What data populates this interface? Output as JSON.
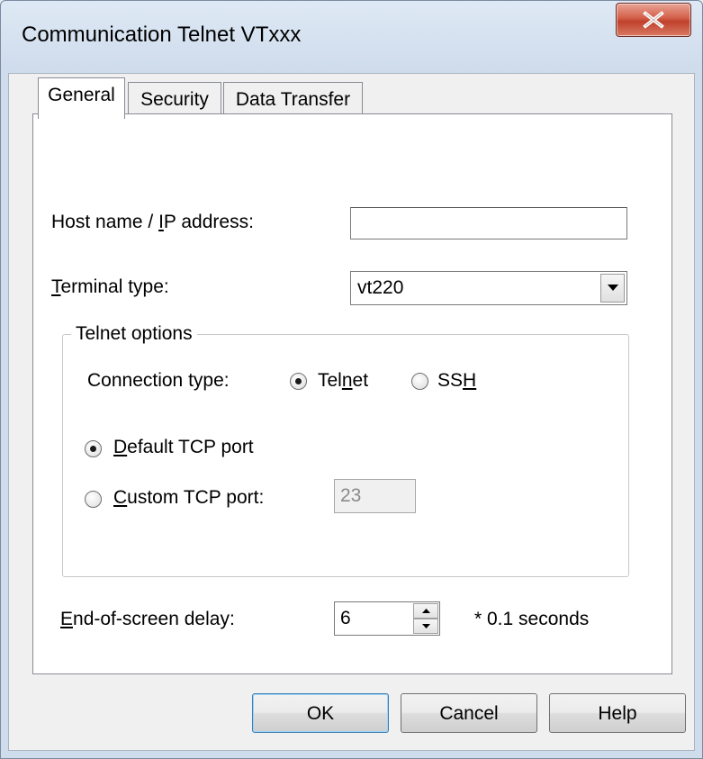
{
  "window": {
    "title": "Communication Telnet VTxxx",
    "close_icon": "close-icon"
  },
  "tabs": [
    {
      "label": "General",
      "active": true
    },
    {
      "label": "Security",
      "active": false
    },
    {
      "label": "Data Transfer",
      "active": false
    }
  ],
  "general": {
    "host": {
      "label": "Host name / IP address:",
      "value": ""
    },
    "terminal_type": {
      "label": "Terminal type:",
      "value": "vt220"
    },
    "telnet_options": {
      "title": "Telnet options",
      "connection_type": {
        "label": "Connection type:",
        "options": [
          {
            "label": "Telnet",
            "selected": true
          },
          {
            "label": "SSH",
            "selected": false
          }
        ]
      },
      "port": {
        "default_label": "Default TCP port",
        "custom_label": "Custom TCP port:",
        "selected": "default",
        "custom_value": "23"
      }
    },
    "eos_delay": {
      "label": "End-of-screen delay:",
      "value": "6",
      "unit": "* 0.1 seconds"
    }
  },
  "buttons": {
    "ok": "OK",
    "cancel": "Cancel",
    "help": "Help"
  },
  "colors": {
    "close_button": "#c8452f",
    "panel_background": "#ffffff",
    "dialog_background": "#f0f0f0"
  }
}
